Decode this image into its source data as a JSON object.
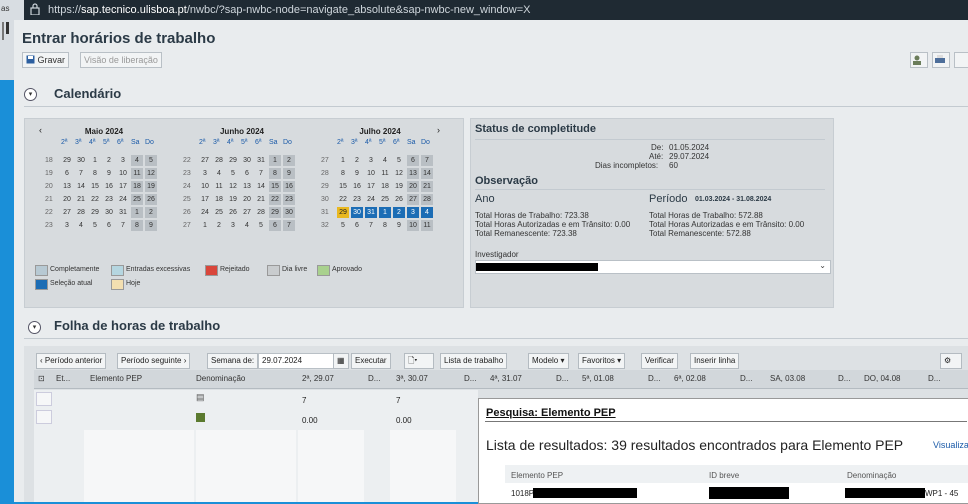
{
  "browser": {
    "url_prefix": "https://",
    "url_host": "sap.tecnico.ulisboa.pt",
    "url_rest": "/nwbc/?sap-nwbc-node=navigate_absolute&sap-nwbc-new_window=X",
    "side_tab_text": "as"
  },
  "page": {
    "title": "Entrar horários de trabalho",
    "toolbar": {
      "save": "Gravar",
      "preview": "Visão de liberação"
    }
  },
  "calendar": {
    "section_title": "Calendário",
    "weekday_headers": [
      "2ª",
      "3ª feira",
      "4ª",
      "5ª",
      "6ª",
      "Sa",
      "Do"
    ],
    "months": [
      {
        "name": "Maio 2024",
        "weeks": [
          {
            "w": "18",
            "d": [
              "29",
              "30",
              "1",
              "2",
              "3",
              "4",
              "5"
            ]
          },
          {
            "w": "19",
            "d": [
              "6",
              "7",
              "8",
              "9",
              "10",
              "11",
              "12"
            ]
          },
          {
            "w": "20",
            "d": [
              "13",
              "14",
              "15",
              "16",
              "17",
              "18",
              "19"
            ]
          },
          {
            "w": "21",
            "d": [
              "20",
              "21",
              "22",
              "23",
              "24",
              "25",
              "26"
            ]
          },
          {
            "w": "22",
            "d": [
              "27",
              "28",
              "29",
              "30",
              "31",
              "1",
              "2"
            ]
          },
          {
            "w": "23",
            "d": [
              "3",
              "4",
              "5",
              "6",
              "7",
              "8",
              "9"
            ]
          }
        ]
      },
      {
        "name": "Junho 2024",
        "weeks": [
          {
            "w": "22",
            "d": [
              "27",
              "28",
              "29",
              "30",
              "31",
              "1",
              "2"
            ]
          },
          {
            "w": "23",
            "d": [
              "3",
              "4",
              "5",
              "6",
              "7",
              "8",
              "9"
            ]
          },
          {
            "w": "24",
            "d": [
              "10",
              "11",
              "12",
              "13",
              "14",
              "15",
              "16"
            ]
          },
          {
            "w": "25",
            "d": [
              "17",
              "18",
              "19",
              "20",
              "21",
              "22",
              "23"
            ]
          },
          {
            "w": "26",
            "d": [
              "24",
              "25",
              "26",
              "27",
              "28",
              "29",
              "30"
            ]
          },
          {
            "w": "27",
            "d": [
              "1",
              "2",
              "3",
              "4",
              "5",
              "6",
              "7"
            ]
          }
        ]
      },
      {
        "name": "Julho 2024",
        "weeks": [
          {
            "w": "27",
            "d": [
              "1",
              "2",
              "3",
              "4",
              "5",
              "6",
              "7"
            ]
          },
          {
            "w": "28",
            "d": [
              "8",
              "9",
              "10",
              "11",
              "12",
              "13",
              "14"
            ]
          },
          {
            "w": "29",
            "d": [
              "15",
              "16",
              "17",
              "18",
              "19",
              "20",
              "21"
            ]
          },
          {
            "w": "30",
            "d": [
              "22",
              "23",
              "24",
              "25",
              "26",
              "27",
              "28"
            ]
          },
          {
            "w": "31",
            "d": [
              "29",
              "30",
              "31",
              "1",
              "2",
              "3",
              "4"
            ]
          },
          {
            "w": "32",
            "d": [
              "5",
              "6",
              "7",
              "8",
              "9",
              "10",
              "11"
            ]
          }
        ]
      }
    ],
    "legend": [
      {
        "label": "Completamente",
        "color": "#b7c9d3"
      },
      {
        "label": "Entradas excessivas",
        "color": "#b5d6e0"
      },
      {
        "label": "Rejeitado",
        "color": "#d9463b"
      },
      {
        "label": "Dia livre",
        "color": "#c9ccce"
      },
      {
        "label": "Aprovado",
        "color": "#a9d18e"
      },
      {
        "label": "Seleção atual",
        "color": "#1c6db5"
      },
      {
        "label": "Hoje",
        "color": "#f3dfb0"
      }
    ]
  },
  "status": {
    "title": "Status de completitude",
    "de_label": "De:",
    "de_value": "01.05.2024",
    "ate_label": "Até:",
    "ate_value": "29.07.2024",
    "dias_label": "Dias incompletos:",
    "dias_value": "60",
    "obs_title": "Observação",
    "ano_label": "Ano",
    "periodo_label": "Período",
    "periodo_value": "01.03.2024 - 31.08.2024",
    "ano_lines": [
      "Total Horas de Trabalho: 723.38",
      "Total Horas Autorizadas e em Trânsito: 0.00",
      "Total Remanescente: 723.38"
    ],
    "periodo_lines": [
      "Total Horas de Trabalho: 572.88",
      "Total Horas Autorizadas e em Trânsito: 0.00",
      "Total Remanescente: 572.88"
    ],
    "investigador_label": "Investigador"
  },
  "timesheet": {
    "section_title": "Folha de horas de trabalho",
    "buttons": {
      "prev": "Período anterior",
      "next": "Período seguinte",
      "week_label": "Semana de:",
      "week_value": "29.07.2024",
      "execute": "Executar",
      "worklist": "Lista de trabalho",
      "model": "Modelo",
      "favorites": "Favoritos",
      "check": "Verificar",
      "insert": "Inserir linha"
    },
    "columns": [
      "Et...",
      "Elemento PEP",
      "Denominação",
      "2ª, 29.07",
      "D...",
      "3ª, 30.07",
      "D...",
      "4ª, 31.07",
      "D...",
      "5ª, 01.08",
      "D...",
      "6ª, 02.08",
      "D...",
      "SA, 03.08",
      "D...",
      "DO, 04.08",
      "D..."
    ],
    "row1_values": [
      "7",
      "7"
    ],
    "row2_values": [
      "0.00",
      "0.00"
    ]
  },
  "popup": {
    "title": "Pesquisa: Elemento PEP",
    "subtitle": "Lista de resultados: 39 resultados encontrados para Elemento PEP",
    "link": "Visualiza",
    "headers": [
      "Elemento PEP",
      "ID breve",
      "Denominação"
    ],
    "row_pep": "1018P",
    "row_den": "WP1 - 45"
  }
}
